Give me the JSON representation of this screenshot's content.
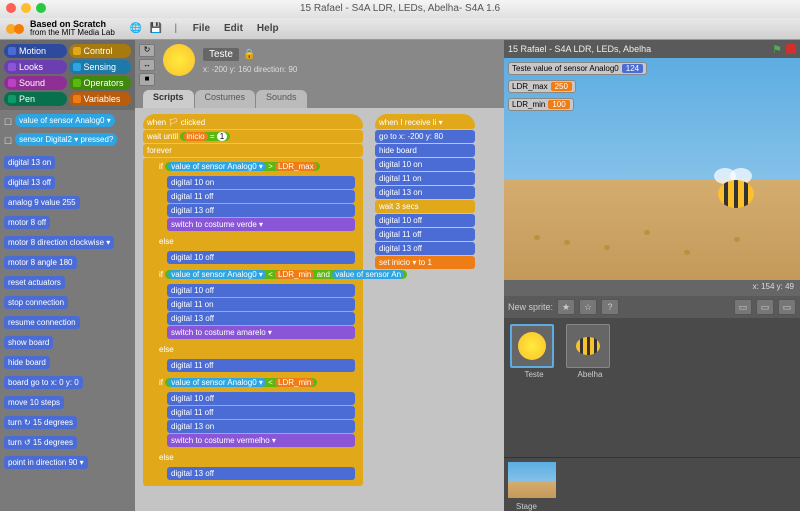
{
  "window_title": "15 Rafael - S4A LDR, LEDs, Abelha- S4A 1.6",
  "branding": {
    "line1": "Based on Scratch",
    "line2": "from the MIT Media Lab"
  },
  "menu": {
    "file": "File",
    "edit": "Edit",
    "help": "Help"
  },
  "categories": {
    "motion": "Motion",
    "control": "Control",
    "looks": "Looks",
    "sensing": "Sensing",
    "sound": "Sound",
    "operators": "Operators",
    "pen": "Pen",
    "variables": "Variables"
  },
  "palette_blocks": [
    {
      "type": "sensing",
      "text": "value of sensor Analog0 ▾",
      "reporter": true,
      "checkbox": true
    },
    {
      "type": "sensing",
      "text": "sensor Digital2 ▾ pressed?",
      "reporter": true,
      "checkbox": true
    },
    {
      "type": "motion",
      "text": "digital 13 on"
    },
    {
      "type": "motion",
      "text": "digital 13 off"
    },
    {
      "type": "motion",
      "text": "analog 9 value 255"
    },
    {
      "type": "motion",
      "text": "motor 8 off"
    },
    {
      "type": "motion",
      "text": "motor 8 direction clockwise ▾"
    },
    {
      "type": "motion",
      "text": "motor 8 angle 180"
    },
    {
      "type": "motion",
      "text": "reset actuators"
    },
    {
      "type": "motion",
      "text": "stop connection"
    },
    {
      "type": "motion",
      "text": "resume connection"
    },
    {
      "type": "motion",
      "text": "show board"
    },
    {
      "type": "motion",
      "text": "hide board"
    },
    {
      "type": "motion",
      "text": "board go to x: 0 y: 0"
    },
    {
      "type": "motion",
      "text": "move 10 steps"
    },
    {
      "type": "motion",
      "text": "turn ↻ 15 degrees"
    },
    {
      "type": "motion",
      "text": "turn ↺ 15 degrees"
    },
    {
      "type": "motion",
      "text": "point in direction 90 ▾"
    }
  ],
  "sprite_info": {
    "name": "Teste",
    "x": "-200",
    "y": "160",
    "direction": "90",
    "coords_label": "x: -200 y: 160   direction: 90"
  },
  "script_tabs": {
    "scripts": "Scripts",
    "costumes": "Costumes",
    "sounds": "Sounds"
  },
  "scripts": {
    "stack1": {
      "hat": "when 🏳 clicked",
      "wait_until": "wait until",
      "wait_cond_var": "inicio",
      "wait_cond_op": "=",
      "wait_cond_val": "1",
      "forever": "forever",
      "if1": "if",
      "op_gt": ">",
      "ldr_max": "LDR_max",
      "sensor": "value of sensor",
      "analog0": "Analog0 ▾",
      "d10_on": "digital 10 on",
      "d11_off": "digital 11 off",
      "d13_off": "digital 13 off",
      "switch_verde": "switch to costume verde ▾",
      "else": "else",
      "d10_off": "digital 10 off",
      "if2": "if",
      "op_lt": "<",
      "ldr_min": "LDR_min",
      "and": "and",
      "d11_on": "digital 11 on",
      "switch_amarelo": "switch to costume amarelo ▾",
      "if3": "if",
      "switch_vermelho": "switch to costume vermelho ▾",
      "d13_on": "digital 13 on"
    },
    "stack2": {
      "hat": "when I receive li ▾",
      "goto": "go to x: -200 y: 80",
      "hide_board": "hide board",
      "d10_on": "digital 10 on",
      "d11_on": "digital 11 on",
      "d13_on": "digital 13 on",
      "wait": "wait 3 secs",
      "d10_off": "digital 10 off",
      "d11_off": "digital 11 off",
      "d13_off": "digital 13 off",
      "set": "set inicio ▾ to 1"
    }
  },
  "stage": {
    "title": "15 Rafael - S4A LDR, LEDs, Abelha",
    "monitors": [
      {
        "label": "Teste value of sensor Analog0",
        "value": "124",
        "color": "blue"
      },
      {
        "label": "LDR_max",
        "value": "250",
        "color": "orange"
      },
      {
        "label": "LDR_min",
        "value": "100",
        "color": "orange"
      }
    ],
    "coords": "x: 154   y: 49"
  },
  "new_sprite_label": "New sprite:",
  "sprites": [
    {
      "name": "Teste",
      "selected": true,
      "icon": "sun"
    },
    {
      "name": "Abelha",
      "selected": false,
      "icon": "bee"
    }
  ],
  "stage_label": "Stage"
}
